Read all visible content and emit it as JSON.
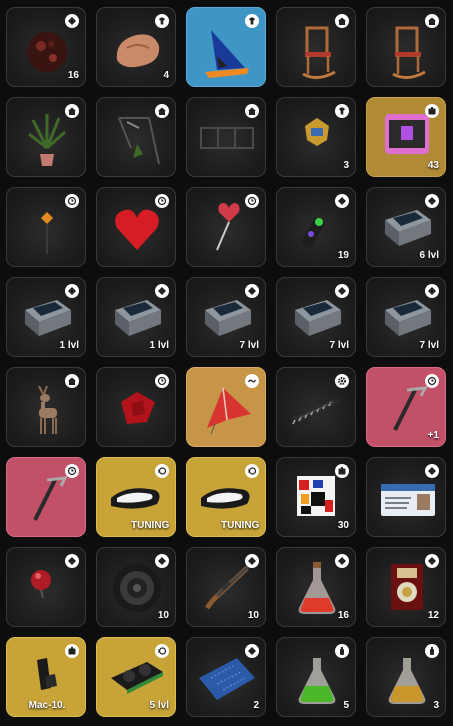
{
  "inventory": {
    "slots": [
      {
        "item_icon": "round-red-rock-icon",
        "type_icon": "diamond-icon",
        "count": "16"
      },
      {
        "item_icon": "copper-ore-icon",
        "type_icon": "shirt-icon",
        "count": "4"
      },
      {
        "item_icon": "blue-hat-icon",
        "type_icon": "shirt-icon",
        "count": ""
      },
      {
        "item_icon": "rocking-chair-icon",
        "type_icon": "house-icon",
        "count": ""
      },
      {
        "item_icon": "rocking-chair-icon",
        "type_icon": "house-icon",
        "count": ""
      },
      {
        "item_icon": "potted-palm-icon",
        "type_icon": "house-icon",
        "count": ""
      },
      {
        "item_icon": "hanging-plant-shelf-icon",
        "type_icon": "house-icon",
        "count": ""
      },
      {
        "item_icon": "dark-fence-icon",
        "type_icon": "house-icon",
        "count": ""
      },
      {
        "item_icon": "gold-badge-icon",
        "type_icon": "shirt-icon",
        "count": "3"
      },
      {
        "item_icon": "loot-case-icon",
        "type_icon": "case-icon",
        "count": "43"
      },
      {
        "item_icon": "sign-post-icon",
        "type_icon": "clock-icon",
        "count": ""
      },
      {
        "item_icon": "red-heart-icon",
        "type_icon": "clock-icon",
        "count": ""
      },
      {
        "item_icon": "heart-lollipop-icon",
        "type_icon": "clock-icon",
        "count": ""
      },
      {
        "item_icon": "spray-can-icon",
        "type_icon": "diamond-icon",
        "count": "19"
      },
      {
        "item_icon": "server-box-icon",
        "type_icon": "diamond-icon",
        "count": "6 lvl"
      },
      {
        "item_icon": "server-box-icon",
        "type_icon": "diamond-icon",
        "count": "1 lvl"
      },
      {
        "item_icon": "server-box-icon",
        "type_icon": "diamond-icon",
        "count": "1 lvl"
      },
      {
        "item_icon": "server-box-icon",
        "type_icon": "diamond-icon",
        "count": "7 lvl"
      },
      {
        "item_icon": "server-box-icon",
        "type_icon": "diamond-icon",
        "count": "7 lvl"
      },
      {
        "item_icon": "server-box-icon",
        "type_icon": "diamond-icon",
        "count": "7 lvl"
      },
      {
        "item_icon": "deer-statue-icon",
        "type_icon": "house-icon",
        "count": ""
      },
      {
        "item_icon": "red-flag-icon",
        "type_icon": "clock-icon",
        "count": ""
      },
      {
        "item_icon": "red-kite-icon",
        "type_icon": "wave-icon",
        "count": ""
      },
      {
        "item_icon": "microchip-icon",
        "type_icon": "gear-icon",
        "count": ""
      },
      {
        "item_icon": "pickaxe-icon",
        "type_icon": "clock-icon",
        "count": "+1"
      },
      {
        "item_icon": "pickaxe-icon",
        "type_icon": "clock-icon",
        "count": ""
      },
      {
        "item_icon": "car-headlight-icon",
        "type_icon": "speed-icon",
        "count": "TUNING"
      },
      {
        "item_icon": "car-headlight-icon",
        "type_icon": "speed-icon",
        "count": "TUNING"
      },
      {
        "item_icon": "qr-sticker-icon",
        "type_icon": "case-icon",
        "count": "30"
      },
      {
        "item_icon": "id-card-icon",
        "type_icon": "diamond-icon",
        "count": ""
      },
      {
        "item_icon": "red-orb-icon",
        "type_icon": "diamond-icon",
        "count": ""
      },
      {
        "item_icon": "speaker-icon",
        "type_icon": "diamond-icon",
        "count": "10"
      },
      {
        "item_icon": "rifle-icon",
        "type_icon": "diamond-icon",
        "count": "10"
      },
      {
        "item_icon": "red-potion-icon",
        "type_icon": "diamond-icon",
        "count": "16"
      },
      {
        "item_icon": "speaker-box-icon",
        "type_icon": "diamond-icon",
        "count": "12"
      },
      {
        "item_icon": "mac10-icon",
        "type_icon": "case-icon",
        "count": "Mac-10."
      },
      {
        "item_icon": "graphics-card-icon",
        "type_icon": "speed-icon",
        "count": "5 lvl"
      },
      {
        "item_icon": "circuit-board-icon",
        "type_icon": "diamond-icon",
        "count": "2"
      },
      {
        "item_icon": "green-potion-icon",
        "type_icon": "bottle-icon",
        "count": "5"
      },
      {
        "item_icon": "gold-potion-icon",
        "type_icon": "bottle-icon",
        "count": "3"
      }
    ]
  }
}
